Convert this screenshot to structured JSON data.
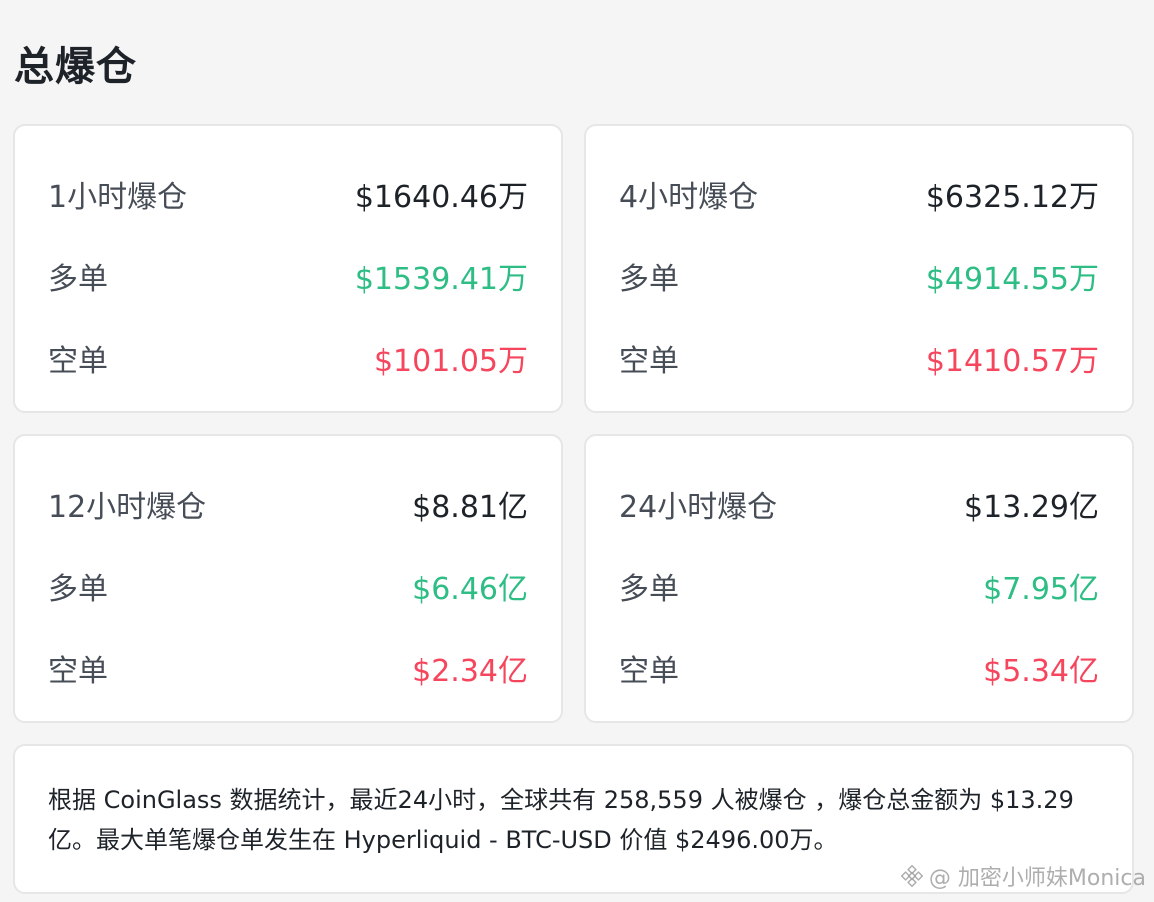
{
  "page": {
    "title": "总爆仓"
  },
  "cards": [
    {
      "period": "1小时爆仓",
      "total": "$1640.46万",
      "long_label": "多单",
      "long": "$1539.41万",
      "short_label": "空单",
      "short": "$101.05万"
    },
    {
      "period": "4小时爆仓",
      "total": "$6325.12万",
      "long_label": "多单",
      "long": "$4914.55万",
      "short_label": "空单",
      "short": "$1410.57万"
    },
    {
      "period": "12小时爆仓",
      "total": "$8.81亿",
      "long_label": "多单",
      "long": "$6.46亿",
      "short_label": "空单",
      "short": "$2.34亿"
    },
    {
      "period": "24小时爆仓",
      "total": "$13.29亿",
      "long_label": "多单",
      "long": "$7.95亿",
      "short_label": "空单",
      "short": "$5.34亿"
    }
  ],
  "summary": {
    "text": "根据 CoinGlass 数据统计，最近24小时，全球共有 258,559 人被爆仓 ，爆仓总金额为 $13.29 亿。最大单笔爆仓单发生在 Hyperliquid - BTC-USD 价值 $2496.00万。"
  },
  "watermark": {
    "text": "@ 加密小师妹Monica"
  },
  "colors": {
    "long": "#2ebd85",
    "short": "#f6465d",
    "text": "#1e2329",
    "label": "#474d57"
  }
}
